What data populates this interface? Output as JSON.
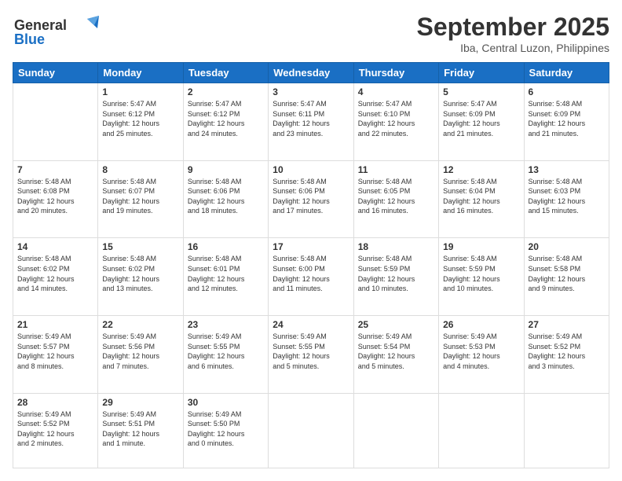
{
  "logo": {
    "line1": "General",
    "line2": "Blue"
  },
  "title": "September 2025",
  "subtitle": "Iba, Central Luzon, Philippines",
  "days_header": [
    "Sunday",
    "Monday",
    "Tuesday",
    "Wednesday",
    "Thursday",
    "Friday",
    "Saturday"
  ],
  "weeks": [
    [
      {
        "num": "",
        "info": ""
      },
      {
        "num": "1",
        "info": "Sunrise: 5:47 AM\nSunset: 6:12 PM\nDaylight: 12 hours\nand 25 minutes."
      },
      {
        "num": "2",
        "info": "Sunrise: 5:47 AM\nSunset: 6:12 PM\nDaylight: 12 hours\nand 24 minutes."
      },
      {
        "num": "3",
        "info": "Sunrise: 5:47 AM\nSunset: 6:11 PM\nDaylight: 12 hours\nand 23 minutes."
      },
      {
        "num": "4",
        "info": "Sunrise: 5:47 AM\nSunset: 6:10 PM\nDaylight: 12 hours\nand 22 minutes."
      },
      {
        "num": "5",
        "info": "Sunrise: 5:47 AM\nSunset: 6:09 PM\nDaylight: 12 hours\nand 21 minutes."
      },
      {
        "num": "6",
        "info": "Sunrise: 5:48 AM\nSunset: 6:09 PM\nDaylight: 12 hours\nand 21 minutes."
      }
    ],
    [
      {
        "num": "7",
        "info": "Sunrise: 5:48 AM\nSunset: 6:08 PM\nDaylight: 12 hours\nand 20 minutes."
      },
      {
        "num": "8",
        "info": "Sunrise: 5:48 AM\nSunset: 6:07 PM\nDaylight: 12 hours\nand 19 minutes."
      },
      {
        "num": "9",
        "info": "Sunrise: 5:48 AM\nSunset: 6:06 PM\nDaylight: 12 hours\nand 18 minutes."
      },
      {
        "num": "10",
        "info": "Sunrise: 5:48 AM\nSunset: 6:06 PM\nDaylight: 12 hours\nand 17 minutes."
      },
      {
        "num": "11",
        "info": "Sunrise: 5:48 AM\nSunset: 6:05 PM\nDaylight: 12 hours\nand 16 minutes."
      },
      {
        "num": "12",
        "info": "Sunrise: 5:48 AM\nSunset: 6:04 PM\nDaylight: 12 hours\nand 16 minutes."
      },
      {
        "num": "13",
        "info": "Sunrise: 5:48 AM\nSunset: 6:03 PM\nDaylight: 12 hours\nand 15 minutes."
      }
    ],
    [
      {
        "num": "14",
        "info": "Sunrise: 5:48 AM\nSunset: 6:02 PM\nDaylight: 12 hours\nand 14 minutes."
      },
      {
        "num": "15",
        "info": "Sunrise: 5:48 AM\nSunset: 6:02 PM\nDaylight: 12 hours\nand 13 minutes."
      },
      {
        "num": "16",
        "info": "Sunrise: 5:48 AM\nSunset: 6:01 PM\nDaylight: 12 hours\nand 12 minutes."
      },
      {
        "num": "17",
        "info": "Sunrise: 5:48 AM\nSunset: 6:00 PM\nDaylight: 12 hours\nand 11 minutes."
      },
      {
        "num": "18",
        "info": "Sunrise: 5:48 AM\nSunset: 5:59 PM\nDaylight: 12 hours\nand 10 minutes."
      },
      {
        "num": "19",
        "info": "Sunrise: 5:48 AM\nSunset: 5:59 PM\nDaylight: 12 hours\nand 10 minutes."
      },
      {
        "num": "20",
        "info": "Sunrise: 5:48 AM\nSunset: 5:58 PM\nDaylight: 12 hours\nand 9 minutes."
      }
    ],
    [
      {
        "num": "21",
        "info": "Sunrise: 5:49 AM\nSunset: 5:57 PM\nDaylight: 12 hours\nand 8 minutes."
      },
      {
        "num": "22",
        "info": "Sunrise: 5:49 AM\nSunset: 5:56 PM\nDaylight: 12 hours\nand 7 minutes."
      },
      {
        "num": "23",
        "info": "Sunrise: 5:49 AM\nSunset: 5:55 PM\nDaylight: 12 hours\nand 6 minutes."
      },
      {
        "num": "24",
        "info": "Sunrise: 5:49 AM\nSunset: 5:55 PM\nDaylight: 12 hours\nand 5 minutes."
      },
      {
        "num": "25",
        "info": "Sunrise: 5:49 AM\nSunset: 5:54 PM\nDaylight: 12 hours\nand 5 minutes."
      },
      {
        "num": "26",
        "info": "Sunrise: 5:49 AM\nSunset: 5:53 PM\nDaylight: 12 hours\nand 4 minutes."
      },
      {
        "num": "27",
        "info": "Sunrise: 5:49 AM\nSunset: 5:52 PM\nDaylight: 12 hours\nand 3 minutes."
      }
    ],
    [
      {
        "num": "28",
        "info": "Sunrise: 5:49 AM\nSunset: 5:52 PM\nDaylight: 12 hours\nand 2 minutes."
      },
      {
        "num": "29",
        "info": "Sunrise: 5:49 AM\nSunset: 5:51 PM\nDaylight: 12 hours\nand 1 minute."
      },
      {
        "num": "30",
        "info": "Sunrise: 5:49 AM\nSunset: 5:50 PM\nDaylight: 12 hours\nand 0 minutes."
      },
      {
        "num": "",
        "info": ""
      },
      {
        "num": "",
        "info": ""
      },
      {
        "num": "",
        "info": ""
      },
      {
        "num": "",
        "info": ""
      }
    ]
  ]
}
